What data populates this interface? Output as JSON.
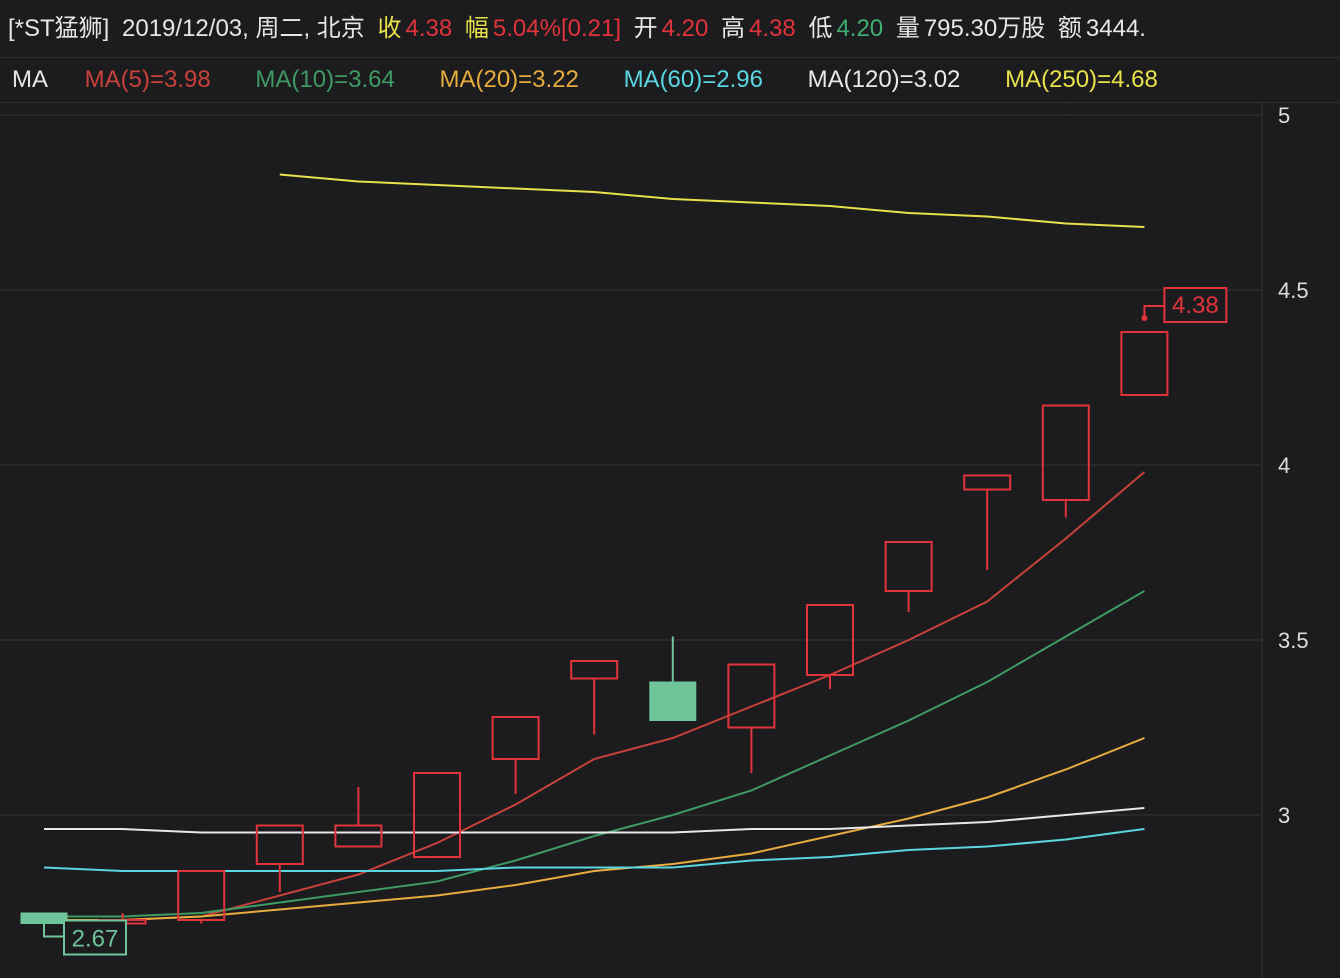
{
  "header": {
    "symbol": "[*ST猛狮]",
    "datetime": "2019/12/03, 周二, 北京",
    "close_label": "收",
    "close_value": "4.38",
    "change_label": "幅",
    "change_value": "5.04%",
    "change_abs": "[0.21]",
    "open_label": "开",
    "open_value": "4.20",
    "high_label": "高",
    "high_value": "4.38",
    "low_label": "低",
    "low_value": "4.20",
    "volume_label": "量",
    "volume_value": "795.30万股",
    "amount_label": "额",
    "amount_value": "3444."
  },
  "ma_bar": {
    "label": "MA",
    "items": [
      {
        "text": "MA(5)=3.98",
        "color": "#c8413a"
      },
      {
        "text": "MA(10)=3.64",
        "color": "#3f9a64"
      },
      {
        "text": "MA(20)=3.22",
        "color": "#e6ac3e"
      },
      {
        "text": "MA(60)=2.96",
        "color": "#5ad6e0"
      },
      {
        "text": "MA(120)=3.02",
        "color": "#e8e8e8"
      },
      {
        "text": "MA(250)=4.68",
        "color": "#e8e24a"
      }
    ]
  },
  "colors": {
    "up": "#e0333b",
    "down": "#6fc59a",
    "grid": "#333336",
    "axis_text": "#dcdcdc"
  },
  "chart_data": {
    "type": "candlestick",
    "ylim": [
      2.6,
      5.05
    ],
    "yticks": [
      3,
      3.5,
      4,
      4.5,
      5
    ],
    "ytick_labels": [
      "3",
      "3.5",
      "4",
      "4.5",
      "5"
    ],
    "candles": [
      {
        "open": 2.72,
        "high": 2.72,
        "low": 2.69,
        "close": 2.69
      },
      {
        "open": 2.69,
        "high": 2.72,
        "low": 2.69,
        "close": 2.7
      },
      {
        "open": 2.7,
        "high": 2.84,
        "low": 2.69,
        "close": 2.84
      },
      {
        "open": 2.86,
        "high": 2.97,
        "low": 2.78,
        "close": 2.97
      },
      {
        "open": 2.91,
        "high": 3.08,
        "low": 2.91,
        "close": 2.97
      },
      {
        "open": 2.88,
        "high": 3.12,
        "low": 2.88,
        "close": 3.12
      },
      {
        "open": 3.16,
        "high": 3.28,
        "low": 3.06,
        "close": 3.28
      },
      {
        "open": 3.39,
        "high": 3.44,
        "low": 3.23,
        "close": 3.44
      },
      {
        "open": 3.38,
        "high": 3.51,
        "low": 3.27,
        "close": 3.27
      },
      {
        "open": 3.25,
        "high": 3.43,
        "low": 3.12,
        "close": 3.43
      },
      {
        "open": 3.4,
        "high": 3.6,
        "low": 3.36,
        "close": 3.6
      },
      {
        "open": 3.64,
        "high": 3.78,
        "low": 3.58,
        "close": 3.78
      },
      {
        "open": 3.93,
        "high": 3.97,
        "low": 3.7,
        "close": 3.97
      },
      {
        "open": 3.9,
        "high": 4.17,
        "low": 3.85,
        "close": 4.17
      },
      {
        "open": 4.2,
        "high": 4.38,
        "low": 4.2,
        "close": 4.38
      }
    ],
    "series": [
      {
        "name": "MA(5)",
        "color": "#c8413a",
        "values": [
          2.7,
          2.7,
          2.71,
          2.77,
          2.83,
          2.92,
          3.03,
          3.16,
          3.22,
          3.31,
          3.4,
          3.5,
          3.61,
          3.79,
          3.98
        ]
      },
      {
        "name": "MA(10)",
        "color": "#3f9a64",
        "values": [
          2.71,
          2.71,
          2.72,
          2.75,
          2.78,
          2.81,
          2.87,
          2.94,
          3.0,
          3.07,
          3.17,
          3.27,
          3.38,
          3.51,
          3.64
        ]
      },
      {
        "name": "MA(20)",
        "color": "#e6ac3e",
        "values": [
          2.7,
          2.7,
          2.71,
          2.73,
          2.75,
          2.77,
          2.8,
          2.84,
          2.86,
          2.89,
          2.94,
          2.99,
          3.05,
          3.13,
          3.22
        ]
      },
      {
        "name": "MA(60)",
        "color": "#5ad6e0",
        "values": [
          2.85,
          2.84,
          2.84,
          2.84,
          2.84,
          2.84,
          2.85,
          2.85,
          2.85,
          2.87,
          2.88,
          2.9,
          2.91,
          2.93,
          2.96
        ]
      },
      {
        "name": "MA(120)",
        "color": "#e8e8e8",
        "values": [
          2.96,
          2.96,
          2.95,
          2.95,
          2.95,
          2.95,
          2.95,
          2.95,
          2.95,
          2.96,
          2.96,
          2.97,
          2.98,
          3.0,
          3.02
        ]
      },
      {
        "name": "MA(250)",
        "color": "#e8e24a",
        "values": [
          null,
          null,
          null,
          4.83,
          4.81,
          4.8,
          4.79,
          4.78,
          4.76,
          4.75,
          4.74,
          4.72,
          4.71,
          4.69,
          4.68
        ]
      }
    ],
    "annotations": {
      "high_marker": "4.38",
      "low_marker": "2.67"
    }
  }
}
